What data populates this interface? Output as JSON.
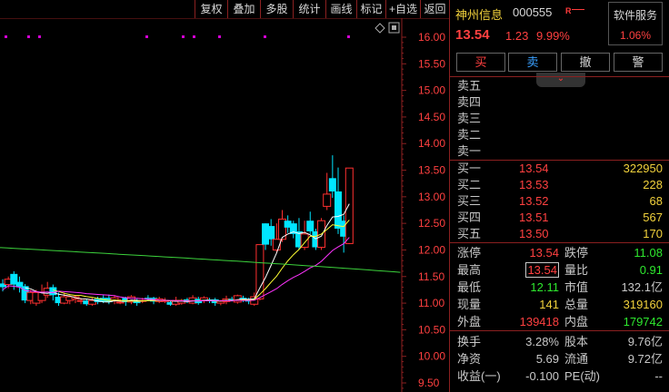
{
  "toolbar": {
    "buttons": [
      {
        "label": "复权"
      },
      {
        "label": "叠加"
      },
      {
        "label": "多股"
      },
      {
        "label": "统计"
      },
      {
        "label": "画线"
      },
      {
        "label": "标记"
      },
      {
        "label": "+自选"
      },
      {
        "label": "返回"
      }
    ]
  },
  "chart_data": {
    "type": "candlestick",
    "y_ticks": [
      "16.00",
      "15.50",
      "15.00",
      "14.50",
      "14.00",
      "13.50",
      "13.00",
      "12.50",
      "12.00",
      "11.50",
      "11.00",
      "10.50",
      "10.00",
      "9.50"
    ],
    "ylim": [
      9.4,
      16.2
    ],
    "candles": [
      {
        "o": 11.37,
        "c": 11.3,
        "h": 11.45,
        "l": 11.22
      },
      {
        "o": 11.35,
        "c": 11.45,
        "h": 11.5,
        "l": 11.28
      },
      {
        "o": 11.55,
        "c": 11.35,
        "h": 11.6,
        "l": 11.25
      },
      {
        "o": 11.4,
        "c": 11.3,
        "h": 11.5,
        "l": 11.2
      },
      {
        "o": 11.32,
        "c": 11.05,
        "h": 11.36,
        "l": 11.0
      },
      {
        "o": 11.05,
        "c": 11.2,
        "h": 11.25,
        "l": 10.98
      },
      {
        "o": 11.0,
        "c": 11.2,
        "h": 11.25,
        "l": 10.95
      },
      {
        "o": 11.05,
        "c": 11.2,
        "h": 11.35,
        "l": 11.0
      },
      {
        "o": 11.15,
        "c": 11.28,
        "h": 11.4,
        "l": 11.1
      },
      {
        "o": 11.3,
        "c": 11.15,
        "h": 11.35,
        "l": 11.05
      },
      {
        "o": 11.12,
        "c": 11.0,
        "h": 11.2,
        "l": 10.95
      },
      {
        "o": 11.0,
        "c": 11.12,
        "h": 11.2,
        "l": 10.98
      },
      {
        "o": 11.05,
        "c": 11.12,
        "h": 11.15,
        "l": 10.98
      },
      {
        "o": 11.08,
        "c": 11.12,
        "h": 11.15,
        "l": 11.0
      },
      {
        "o": 11.05,
        "c": 11.05,
        "h": 11.1,
        "l": 10.98
      },
      {
        "o": 11.05,
        "c": 10.98,
        "h": 11.08,
        "l": 10.95
      },
      {
        "o": 10.98,
        "c": 11.05,
        "h": 11.1,
        "l": 10.95
      },
      {
        "o": 11.08,
        "c": 11.02,
        "h": 11.12,
        "l": 10.98
      },
      {
        "o": 11.1,
        "c": 11.03,
        "h": 11.15,
        "l": 11.0
      },
      {
        "o": 11.1,
        "c": 11.02,
        "h": 11.16,
        "l": 10.98
      },
      {
        "o": 11.05,
        "c": 11.1,
        "h": 11.15,
        "l": 10.98
      },
      {
        "o": 11.02,
        "c": 11.02,
        "h": 11.08,
        "l": 10.98
      },
      {
        "o": 11.1,
        "c": 11.02,
        "h": 11.12,
        "l": 10.95
      },
      {
        "o": 11.02,
        "c": 11.12,
        "h": 11.15,
        "l": 10.98
      },
      {
        "o": 11.05,
        "c": 11.0,
        "h": 11.08,
        "l": 10.95
      },
      {
        "o": 11.05,
        "c": 11.05,
        "h": 11.1,
        "l": 11.0
      },
      {
        "o": 11.1,
        "c": 11.08,
        "h": 11.15,
        "l": 11.05
      },
      {
        "o": 11.1,
        "c": 11.03,
        "h": 11.12,
        "l": 10.98
      },
      {
        "o": 11.03,
        "c": 11.08,
        "h": 11.12,
        "l": 11.0
      },
      {
        "o": 11.05,
        "c": 11.05,
        "h": 11.1,
        "l": 11.0
      },
      {
        "o": 11.02,
        "c": 10.97,
        "h": 11.05,
        "l": 10.95
      },
      {
        "o": 10.98,
        "c": 11.05,
        "h": 11.12,
        "l": 10.95
      },
      {
        "o": 11.0,
        "c": 11.05,
        "h": 11.08,
        "l": 10.97
      },
      {
        "o": 11.07,
        "c": 11.02,
        "h": 11.1,
        "l": 11.0
      },
      {
        "o": 11.0,
        "c": 11.1,
        "h": 11.15,
        "l": 10.98
      },
      {
        "o": 11.08,
        "c": 11.0,
        "h": 11.12,
        "l": 10.97
      },
      {
        "o": 11.05,
        "c": 11.1,
        "h": 11.13,
        "l": 11.0
      },
      {
        "o": 11.07,
        "c": 11.05,
        "h": 11.1,
        "l": 11.0
      },
      {
        "o": 11.07,
        "c": 11.0,
        "h": 11.1,
        "l": 10.95
      },
      {
        "o": 11.0,
        "c": 11.04,
        "h": 11.06,
        "l": 10.96
      },
      {
        "o": 11.03,
        "c": 11.08,
        "h": 11.14,
        "l": 10.98
      },
      {
        "o": 11.08,
        "c": 11.06,
        "h": 11.12,
        "l": 11.03
      },
      {
        "o": 11.02,
        "c": 11.14,
        "h": 11.16,
        "l": 10.99
      },
      {
        "o": 11.1,
        "c": 11.05,
        "h": 11.14,
        "l": 11.02
      },
      {
        "o": 11.08,
        "c": 11.03,
        "h": 11.1,
        "l": 10.98
      },
      {
        "o": 10.98,
        "c": 11.12,
        "h": 11.2,
        "l": 10.95
      },
      {
        "o": 11.08,
        "c": 12.1,
        "h": 12.1,
        "l": 11.05
      },
      {
        "o": 12.5,
        "c": 12.1,
        "h": 12.5,
        "l": 12.0
      },
      {
        "o": 12.45,
        "c": 12.2,
        "h": 12.58,
        "l": 12.08
      },
      {
        "o": 12.0,
        "c": 12.2,
        "h": 12.5,
        "l": 11.95
      },
      {
        "o": 12.2,
        "c": 12.58,
        "h": 12.75,
        "l": 12.15
      },
      {
        "o": 12.55,
        "c": 12.42,
        "h": 12.65,
        "l": 12.32
      },
      {
        "o": 12.5,
        "c": 12.3,
        "h": 12.55,
        "l": 12.22
      },
      {
        "o": 12.35,
        "c": 12.05,
        "h": 12.6,
        "l": 12.0
      },
      {
        "o": 12.05,
        "c": 12.3,
        "h": 12.55,
        "l": 12.0
      },
      {
        "o": 12.55,
        "c": 12.35,
        "h": 12.72,
        "l": 12.3
      },
      {
        "o": 12.35,
        "c": 12.05,
        "h": 12.4,
        "l": 12.0
      },
      {
        "o": 12.05,
        "c": 12.55,
        "h": 12.6,
        "l": 12.0
      },
      {
        "o": 12.82,
        "c": 13.05,
        "h": 13.45,
        "l": 12.75
      },
      {
        "o": 13.35,
        "c": 13.1,
        "h": 13.78,
        "l": 12.98
      },
      {
        "o": 13.1,
        "c": 12.4,
        "h": 13.55,
        "l": 12.3
      },
      {
        "o": 12.55,
        "c": 12.25,
        "h": 12.65,
        "l": 11.95
      },
      {
        "o": 12.12,
        "c": 13.54,
        "h": 13.54,
        "l": 12.11
      }
    ],
    "dots_top": true,
    "lines": [
      "white-ma",
      "yellow-ma",
      "magenta-ma",
      "green-ma"
    ]
  },
  "side": {
    "name": "神州信息",
    "code": "000555",
    "badge": "R",
    "price": "13.54",
    "change": "1.23",
    "change_pct": "9.99%",
    "svc_label": "软件服务",
    "svc_value": "1.06%",
    "buy_btn": "买",
    "sell_btn": "卖",
    "cancel_btn": "撤",
    "alert_btn": "警",
    "fold_icon": "⌄",
    "asks": [
      {
        "label": "卖五",
        "price": "",
        "vol": ""
      },
      {
        "label": "卖四",
        "price": "",
        "vol": ""
      },
      {
        "label": "卖三",
        "price": "",
        "vol": ""
      },
      {
        "label": "卖二",
        "price": "",
        "vol": ""
      },
      {
        "label": "卖一",
        "price": "",
        "vol": ""
      }
    ],
    "bids": [
      {
        "label": "买一",
        "price": "13.54",
        "vol": "322950"
      },
      {
        "label": "买二",
        "price": "13.53",
        "vol": "228"
      },
      {
        "label": "买三",
        "price": "13.52",
        "vol": "68"
      },
      {
        "label": "买四",
        "price": "13.51",
        "vol": "567"
      },
      {
        "label": "买五",
        "price": "13.50",
        "vol": "170"
      }
    ],
    "stats": [
      {
        "l1": "涨停",
        "v1": "13.54",
        "c1": "#ff4040",
        "l2": "跌停",
        "v2": "11.08",
        "c2": "#2ee82e"
      },
      {
        "l1": "最高",
        "v1": "13.54",
        "c1": "#ff4040",
        "l2": "量比",
        "v2": "0.91",
        "c2": "#2ee82e",
        "boxed": true
      },
      {
        "l1": "最低",
        "v1": "12.11",
        "c1": "#2ee82e",
        "l2": "市值",
        "v2": "132.1亿",
        "c2": "#c8c8c8"
      },
      {
        "l1": "现量",
        "v1": "141",
        "c1": "#f2d23c",
        "l2": "总量",
        "v2": "319160",
        "c2": "#f2d23c"
      },
      {
        "l1": "外盘",
        "v1": "139418",
        "c1": "#ff4040",
        "l2": "内盘",
        "v2": "179742",
        "c2": "#2ee82e"
      }
    ],
    "stats2": [
      {
        "l1": "换手",
        "v1": "3.28%",
        "c1": "#c8c8c8",
        "l2": "股本",
        "v2": "9.76亿",
        "c2": "#c8c8c8"
      },
      {
        "l1": "净资",
        "v1": "5.69",
        "c1": "#c8c8c8",
        "l2": "流通",
        "v2": "9.72亿",
        "c2": "#c8c8c8"
      },
      {
        "l1": "收益(一)",
        "v1": "-0.100",
        "c1": "#c8c8c8",
        "l2": "PE(动)",
        "v2": "--",
        "c2": "#c8c8c8"
      }
    ]
  }
}
